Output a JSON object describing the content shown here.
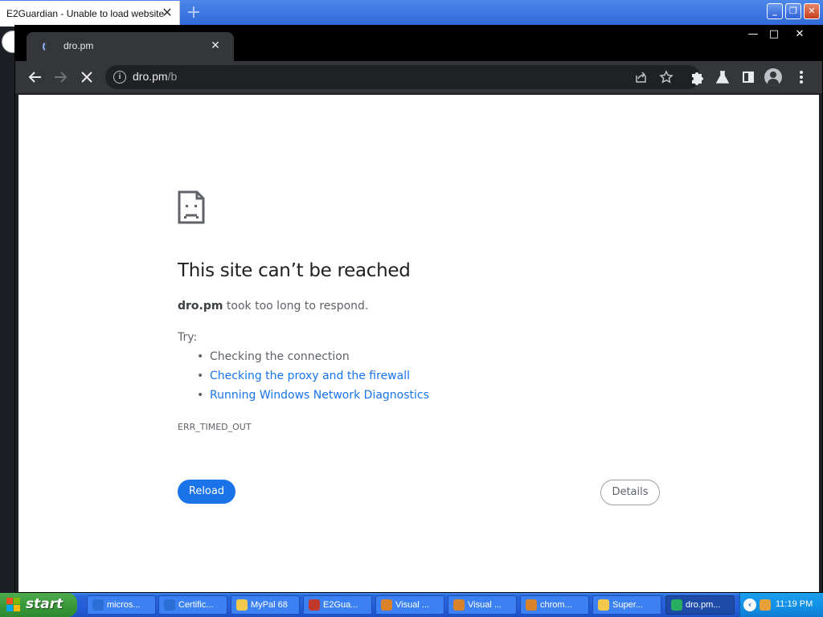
{
  "background_browser": {
    "tab_title": "E2Guardian - Unable to load website",
    "close_glyph": "✕",
    "newtab_glyph": "+",
    "window_buttons": [
      "_",
      "❐",
      "✕"
    ]
  },
  "window": {
    "controls": [
      "—",
      "□",
      "✕"
    ]
  },
  "tab": {
    "title": "dro.pm",
    "close_glyph": "✕"
  },
  "toolbar": {
    "back_icon": "arrow-left-icon",
    "forward_icon": "arrow-right-icon",
    "stop_icon": "close-icon",
    "url_host": "dro.pm",
    "url_path": "/b",
    "share_icon": "share-icon",
    "bookmark_icon": "star-icon",
    "extensions_icon": "puzzle-icon",
    "labs_icon": "flask-icon",
    "sidepanel_icon": "sidepanel-icon",
    "profile_icon": "avatar-icon",
    "menu_icon": "kebab-menu-icon"
  },
  "error_page": {
    "title": "This site can’t be reached",
    "host": "dro.pm",
    "description_rest": " took too long to respond.",
    "try_label": "Try:",
    "suggestions": [
      {
        "text": "Checking the connection",
        "link": false
      },
      {
        "text": "Checking the proxy and the firewall",
        "link": true
      },
      {
        "text": "Running Windows Network Diagnostics",
        "link": true
      }
    ],
    "error_code": "ERR_TIMED_OUT",
    "reload_label": "Reload",
    "details_label": "Details"
  },
  "taskbar": {
    "start_label": "start",
    "tasks": [
      {
        "label": "micros...",
        "icon_color": "#2b6fd6",
        "active": false
      },
      {
        "label": "Certific...",
        "icon_color": "#2b6fd6",
        "active": false
      },
      {
        "label": "MyPal 68",
        "icon_color": "#f2c94c",
        "active": false
      },
      {
        "label": "E2Gua...",
        "icon_color": "#c0392b",
        "active": false
      },
      {
        "label": "Visual ...",
        "icon_color": "#d9822b",
        "active": false
      },
      {
        "label": "Visual ...",
        "icon_color": "#d9822b",
        "active": false
      },
      {
        "label": "chrom...",
        "icon_color": "#d9822b",
        "active": false
      },
      {
        "label": "Super...",
        "icon_color": "#f2c94c",
        "active": false
      },
      {
        "label": "dro.pm...",
        "icon_color": "#27ae60",
        "active": true
      }
    ],
    "tray_chevron": "‹",
    "clock": "11:19 PM"
  }
}
